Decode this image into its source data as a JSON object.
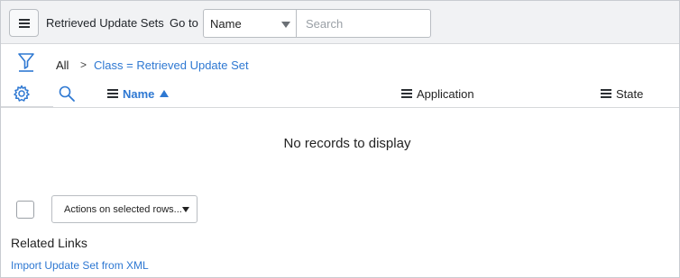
{
  "header": {
    "title": "Retrieved Update Sets",
    "goto_label": "Go to",
    "field_select": "Name",
    "search_placeholder": "Search"
  },
  "breadcrumb": {
    "all": "All",
    "separator": ">",
    "condition": "Class = Retrieved Update Set"
  },
  "columns": [
    {
      "label": "Name",
      "sorted": "ascending"
    },
    {
      "label": "Application"
    },
    {
      "label": "State"
    }
  ],
  "empty_message": "No records to display",
  "actions": {
    "label": "Actions on selected rows..."
  },
  "related_links": {
    "title": "Related Links",
    "items": [
      "Import Update Set from XML"
    ]
  },
  "colors": {
    "accent": "#2e78d2",
    "header_bg": "#f1f2f4",
    "border": "#b9bdc2"
  }
}
